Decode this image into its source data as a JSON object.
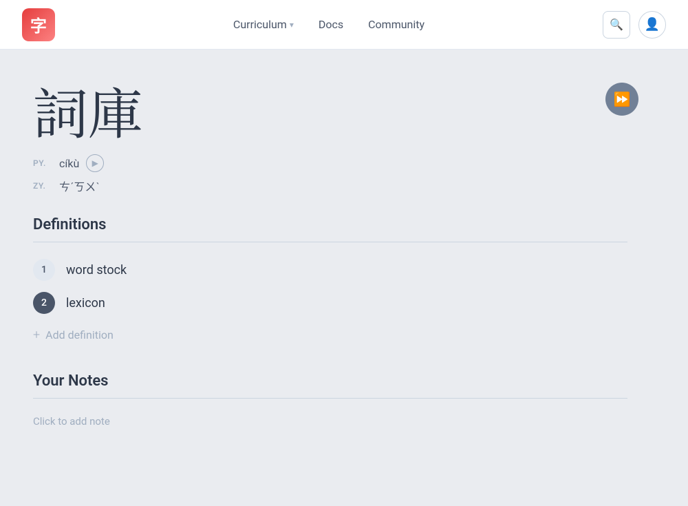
{
  "header": {
    "logo_char": "字",
    "nav": [
      {
        "label": "Curriculum",
        "has_dropdown": true
      },
      {
        "label": "Docs",
        "has_dropdown": false
      },
      {
        "label": "Community",
        "has_dropdown": false
      }
    ],
    "search_label": "search",
    "profile_label": "profile"
  },
  "character": {
    "hanzi": "詞庫",
    "pinyin_label": "PY.",
    "pinyin_value": "cíkù",
    "zhuyin_label": "ZY.",
    "zhuyin_value": "ㄘˊㄎㄨˋ"
  },
  "definitions": {
    "section_title": "Definitions",
    "items": [
      {
        "number": "1",
        "text": "word stock"
      },
      {
        "number": "2",
        "text": "lexicon"
      }
    ],
    "add_label": "Add definition"
  },
  "notes": {
    "section_title": "Your Notes",
    "placeholder": "Click to add note"
  },
  "ff_button_label": "⏭"
}
